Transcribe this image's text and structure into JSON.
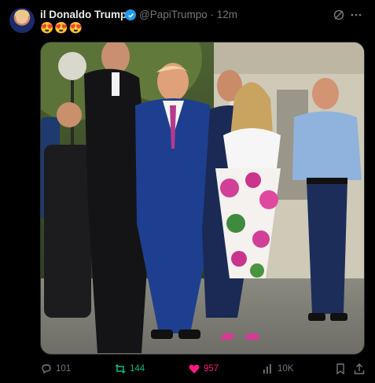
{
  "tweet": {
    "display_name": "il Donaldo Trumpo",
    "handle": "@PapiTrumpo",
    "separator": "·",
    "time": "12m",
    "text": "😍😍😍",
    "verified": true
  },
  "actions": {
    "replies": "101",
    "reposts": "144",
    "likes": "957",
    "views": "10K"
  },
  "icons": {
    "grok": "grok-icon",
    "more": "more-icon",
    "reply": "reply-icon",
    "repost": "repost-icon",
    "like": "heart-icon",
    "views": "views-icon",
    "bookmark": "bookmark-icon",
    "share": "share-icon"
  },
  "colors": {
    "background": "#000000",
    "text": "#e7e9ea",
    "muted": "#71767b",
    "verified": "#1d9bf0",
    "repost_active": "#00ba7c",
    "like_active": "#f91880"
  }
}
